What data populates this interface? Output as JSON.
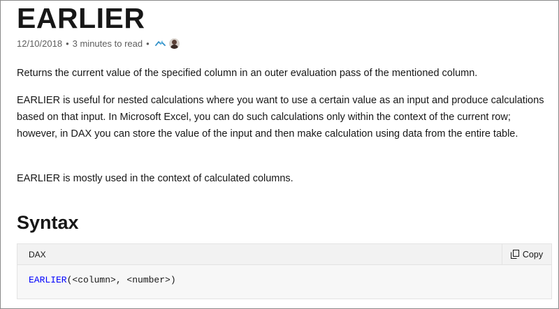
{
  "page": {
    "title": "EARLIER",
    "meta": {
      "date": "12/10/2018",
      "separator": "•",
      "read_time": "3 minutes to read",
      "separator2": "•"
    },
    "paragraphs": [
      "Returns the current value of the specified column in an outer evaluation pass of the mentioned column.",
      "EARLIER is useful for nested calculations where you want to use a certain value as an input and produce calculations based on that input. In Microsoft Excel, you can do such calculations only within the context of the current row; however, in DAX you can store the value of the input and then make calculation using data from the entire table.",
      "EARLIER is mostly used in the context of calculated columns."
    ],
    "syntax_heading": "Syntax"
  },
  "code": {
    "language": "DAX",
    "copy_label": "Copy",
    "function_name": "EARLIER",
    "arguments": "(<column>, <number>)"
  },
  "colors": {
    "code_function": "#0101fd",
    "contributor_icon": "#2f8fc8",
    "text": "#171717",
    "meta_text": "#5e5e5e"
  },
  "icons": {
    "contributor": "contributor-icon",
    "avatar": "avatar",
    "copy": "copy-icon"
  }
}
